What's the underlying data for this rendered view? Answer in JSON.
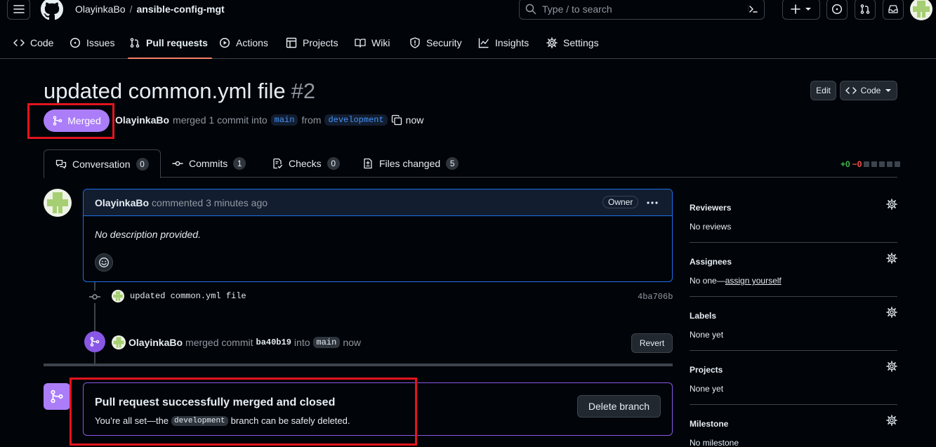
{
  "header": {
    "owner": "OlayinkaBo",
    "separator": "/",
    "repo": "ansible-config-mgt",
    "search_placeholder": "Type / to search"
  },
  "nav": {
    "items": [
      {
        "label": "Code",
        "icon": "code-icon"
      },
      {
        "label": "Issues",
        "icon": "issue-opened-icon"
      },
      {
        "label": "Pull requests",
        "icon": "git-pull-request-icon",
        "active": true
      },
      {
        "label": "Actions",
        "icon": "play-icon"
      },
      {
        "label": "Projects",
        "icon": "table-icon"
      },
      {
        "label": "Wiki",
        "icon": "book-icon"
      },
      {
        "label": "Security",
        "icon": "shield-icon"
      },
      {
        "label": "Insights",
        "icon": "graph-icon"
      },
      {
        "label": "Settings",
        "icon": "gear-icon"
      }
    ]
  },
  "pr": {
    "title": "updated common.yml file",
    "number": "#2",
    "edit_label": "Edit",
    "code_label": "Code",
    "state_label": "Merged",
    "author": "OlayinkaBo",
    "action_text": "merged 1 commit into",
    "base_branch": "main",
    "from_text": "from",
    "head_branch": "development",
    "time": "now"
  },
  "tabs": [
    {
      "label": "Conversation",
      "count": "0",
      "icon": "comment-discussion-icon"
    },
    {
      "label": "Commits",
      "count": "1",
      "icon": "git-commit-icon"
    },
    {
      "label": "Checks",
      "count": "0",
      "icon": "checklist-icon"
    },
    {
      "label": "Files changed",
      "count": "5",
      "icon": "file-diff-icon"
    }
  ],
  "diffstat": {
    "additions": "+0",
    "deletions": "−0"
  },
  "comment": {
    "author": "OlayinkaBo",
    "meta": "commented 3 minutes ago",
    "badge": "Owner",
    "body": "No description provided."
  },
  "commit": {
    "message": "updated common.yml file",
    "sha": "4ba706b"
  },
  "merge_event": {
    "author": "OlayinkaBo",
    "text1": "merged commit",
    "sha": "ba40b19",
    "text2": "into",
    "branch": "main",
    "time": "now",
    "revert_label": "Revert"
  },
  "merge_box": {
    "title": "Pull request successfully merged and closed",
    "sub_prefix": "You’re all set—the",
    "branch": "development",
    "sub_suffix": "branch can be safely deleted.",
    "delete_label": "Delete branch"
  },
  "sidebar": {
    "reviewers": {
      "title": "Reviewers",
      "value": "No reviews"
    },
    "assignees": {
      "title": "Assignees",
      "value_prefix": "No one—",
      "link": "assign yourself"
    },
    "labels": {
      "title": "Labels",
      "value": "None yet"
    },
    "projects": {
      "title": "Projects",
      "value": "None yet"
    },
    "milestone": {
      "title": "Milestone",
      "value": "No milestone"
    }
  },
  "colors": {
    "merged": "#ab7df8",
    "accent_underline": "#f78166",
    "link": "#4493f8",
    "highlight_box": "#e3141d"
  }
}
